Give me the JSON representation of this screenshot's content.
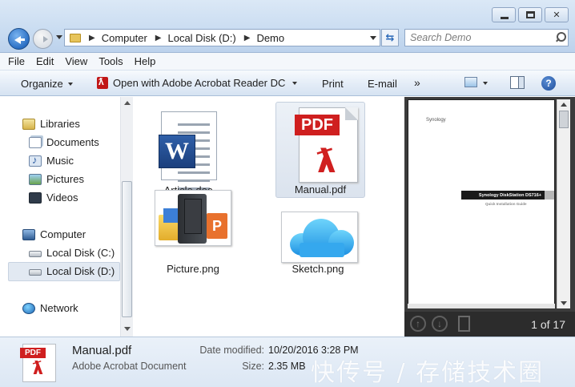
{
  "window": {
    "controls": [
      "minimize",
      "maximize",
      "close"
    ]
  },
  "address": {
    "crumbs": [
      "Computer",
      "Local Disk (D:)",
      "Demo"
    ]
  },
  "search": {
    "placeholder": "Search Demo"
  },
  "menu": [
    "File",
    "Edit",
    "View",
    "Tools",
    "Help"
  ],
  "toolbar": {
    "organize": "Organize",
    "open_with": "Open with Adobe Acrobat Reader DC",
    "print": "Print",
    "email": "E-mail",
    "more": "»"
  },
  "nav": {
    "libraries": "Libraries",
    "documents": "Documents",
    "music": "Music",
    "pictures": "Pictures",
    "videos": "Videos",
    "computer": "Computer",
    "disk_c": "Local Disk (C:)",
    "disk_d": "Local Disk (D:)",
    "network": "Network"
  },
  "files": [
    {
      "name": "Article.doc",
      "icon": "word-doc-icon"
    },
    {
      "name": "Manual.pdf",
      "icon": "pdf-icon",
      "selected": true
    },
    {
      "name": "Picture.png",
      "icon": "picture-thumbnail"
    },
    {
      "name": "Sketch.png",
      "icon": "cloud-thumbnail"
    }
  ],
  "preview": {
    "logo": "Synology",
    "band_title": "Synology DiskStation DS716+",
    "subtitle": "Quick Installation Guide",
    "page_indicator": "1 of 17"
  },
  "details": {
    "name": "Manual.pdf",
    "type": "Adobe Acrobat Document",
    "date_label": "Date modified:",
    "date_value": "10/20/2016 3:28 PM",
    "size_label": "Size:",
    "size_value": "2.35 MB"
  },
  "watermark": "快传号 / 存储技术圈",
  "colors": {
    "titlebar": "#c9dcf1",
    "selection": "#dbe3ee",
    "pdf_red": "#cf1f1f"
  }
}
